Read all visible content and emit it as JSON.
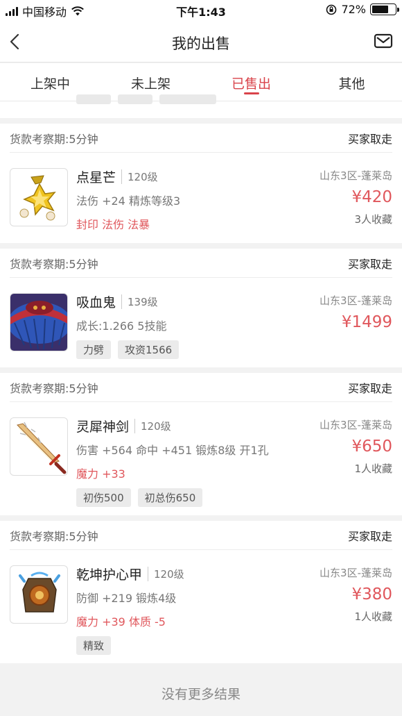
{
  "status_bar": {
    "carrier": "中国移动",
    "time": "下午1:43",
    "battery": "72%",
    "battery_level": 0.72
  },
  "nav": {
    "title": "我的出售",
    "back_icon": "chevron-left-icon",
    "mail_icon": "envelope-icon"
  },
  "tabs": [
    {
      "label": "上架中",
      "active": false
    },
    {
      "label": "未上架",
      "active": false
    },
    {
      "label": "已售出",
      "active": true
    },
    {
      "label": "其他",
      "active": false
    }
  ],
  "items": [
    {
      "period": "货款考察期:5分钟",
      "status": "买家取走",
      "name": "点星芒",
      "level": "120级",
      "attr": "法伤 +24 精炼等级3",
      "special": "封印 法伤 法暴",
      "tags": [],
      "server": "山东3区-蓬莱岛",
      "price": "¥420",
      "favs": "3人收藏",
      "icon": "golden-star-pendant-icon"
    },
    {
      "period": "货款考察期:5分钟",
      "status": "买家取走",
      "name": "吸血鬼",
      "level": "139级",
      "attr": "成长:1.266 5技能",
      "special": "",
      "tags": [
        "力劈",
        "攻资1566"
      ],
      "server": "山东3区-蓬莱岛",
      "price": "¥1499",
      "favs": "",
      "icon": "vampire-pet-icon"
    },
    {
      "period": "货款考察期:5分钟",
      "status": "买家取走",
      "name": "灵犀神剑",
      "level": "120级",
      "attr": "伤害 +564 命中 +451 锻炼8级 开1孔",
      "special": "魔力 +33",
      "tags": [
        "初伤500",
        "初总伤650"
      ],
      "server": "山东3区-蓬莱岛",
      "price": "¥650",
      "favs": "1人收藏",
      "icon": "sword-icon"
    },
    {
      "period": "货款考察期:5分钟",
      "status": "买家取走",
      "name": "乾坤护心甲",
      "level": "120级",
      "attr": "防御 +219 锻炼4级",
      "special": "魔力 +39 体质 -5",
      "tags": [
        "精致"
      ],
      "server": "山东3区-蓬莱岛",
      "price": "¥380",
      "favs": "1人收藏",
      "icon": "armor-icon"
    }
  ],
  "footer": {
    "no_more": "没有更多结果"
  }
}
